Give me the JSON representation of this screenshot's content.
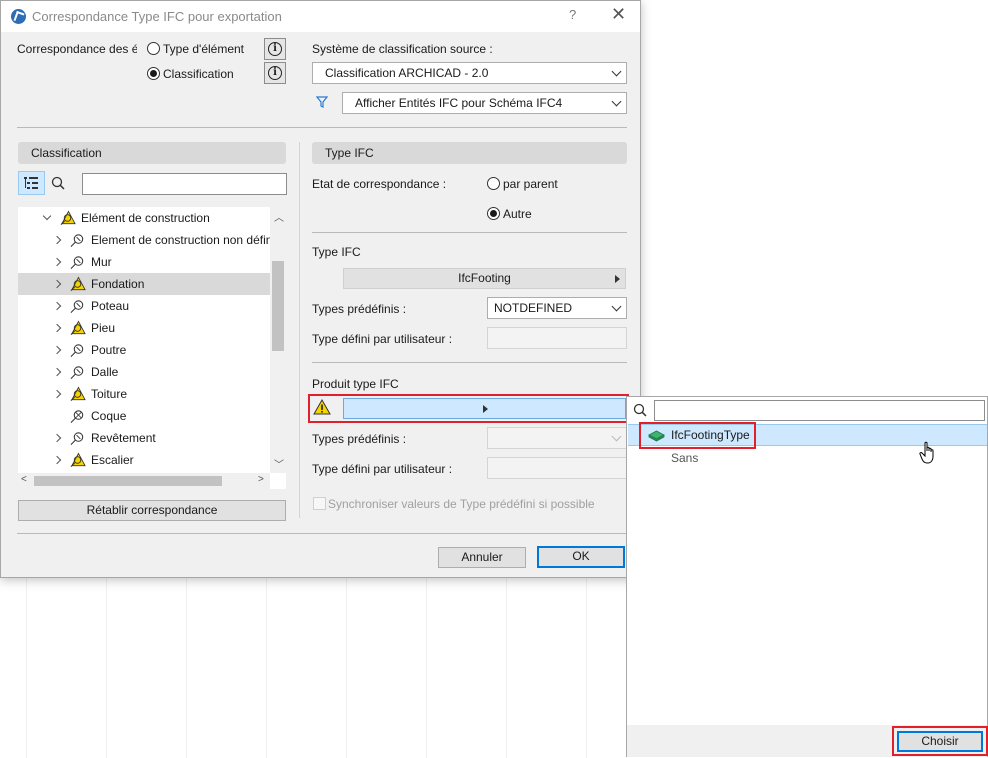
{
  "dialog": {
    "title": "Correspondance Type IFC pour exportation",
    "help": "?",
    "close": "✕"
  },
  "mapping": {
    "label": "Correspondance des élé",
    "option_element_type": "Type d'élément",
    "option_classification": "Classification",
    "selected": "Classification"
  },
  "source": {
    "label": "Système de classification source :",
    "value": "Classification ARCHICAD - 2.0",
    "filter_value": "Afficher Entités IFC pour Schéma IFC4"
  },
  "left_panel": {
    "header": "Classification",
    "search_value": "",
    "tree": [
      {
        "label": "Elément de construction",
        "icon": "warning-branch-icon",
        "level": 0,
        "expanded": true,
        "selected": false
      },
      {
        "label": "Element de construction non défin",
        "icon": "branch-icon",
        "level": 1,
        "expanded": false,
        "selected": false
      },
      {
        "label": "Mur",
        "icon": "branch-icon",
        "level": 1,
        "expanded": false,
        "selected": false
      },
      {
        "label": "Fondation",
        "icon": "warning-branch-icon",
        "level": 1,
        "expanded": false,
        "selected": true
      },
      {
        "label": "Poteau",
        "icon": "branch-icon",
        "level": 1,
        "expanded": false,
        "selected": false
      },
      {
        "label": "Pieu",
        "icon": "warning-branch-icon",
        "level": 1,
        "expanded": false,
        "selected": false
      },
      {
        "label": "Poutre",
        "icon": "branch-icon",
        "level": 1,
        "expanded": false,
        "selected": false
      },
      {
        "label": "Dalle",
        "icon": "branch-icon",
        "level": 1,
        "expanded": false,
        "selected": false
      },
      {
        "label": "Toiture",
        "icon": "warning-branch-icon",
        "level": 1,
        "expanded": false,
        "selected": false
      },
      {
        "label": "Coque",
        "icon": "leaf-icon",
        "level": 1,
        "expanded": false,
        "selected": false
      },
      {
        "label": "Revêtement",
        "icon": "branch-icon",
        "level": 1,
        "expanded": false,
        "selected": false
      },
      {
        "label": "Escalier",
        "icon": "warning-branch-icon",
        "level": 1,
        "expanded": false,
        "selected": false
      }
    ],
    "reset_button": "Rétablir correspondance"
  },
  "right_panel": {
    "header": "Type IFC",
    "mapping_state_label": "Etat de correspondance :",
    "option_by_parent": "par parent",
    "option_other": "Autre",
    "selected_state": "Autre",
    "ifc_type_label": "Type IFC",
    "ifc_type_value": "IfcFooting",
    "predefined_label": "Types prédéfinis :",
    "predefined_value": "NOTDEFINED",
    "user_defined_label": "Type défini par utilisateur :",
    "user_defined_value": "",
    "product_label": "Produit type IFC",
    "product_value": "",
    "product_predefined_label": "Types prédéfinis :",
    "product_predefined_value": "",
    "product_user_defined_label": "Type défini par utilisateur :",
    "product_user_defined_value": "",
    "sync_label": "Synchroniser valeurs de Type prédéfini si possible"
  },
  "footer": {
    "cancel": "Annuler",
    "ok": "OK"
  },
  "popup": {
    "search_value": "",
    "items": [
      {
        "label": "IfcFootingType",
        "selected": true,
        "icon": "ifc-footing-type-icon"
      },
      {
        "label": "Sans",
        "selected": false
      }
    ],
    "choose_button": "Choisir"
  },
  "colors": {
    "highlight": "#e0202a",
    "accent": "#0078d7",
    "selection": "#cde8ff",
    "warning": "#f5d400"
  }
}
